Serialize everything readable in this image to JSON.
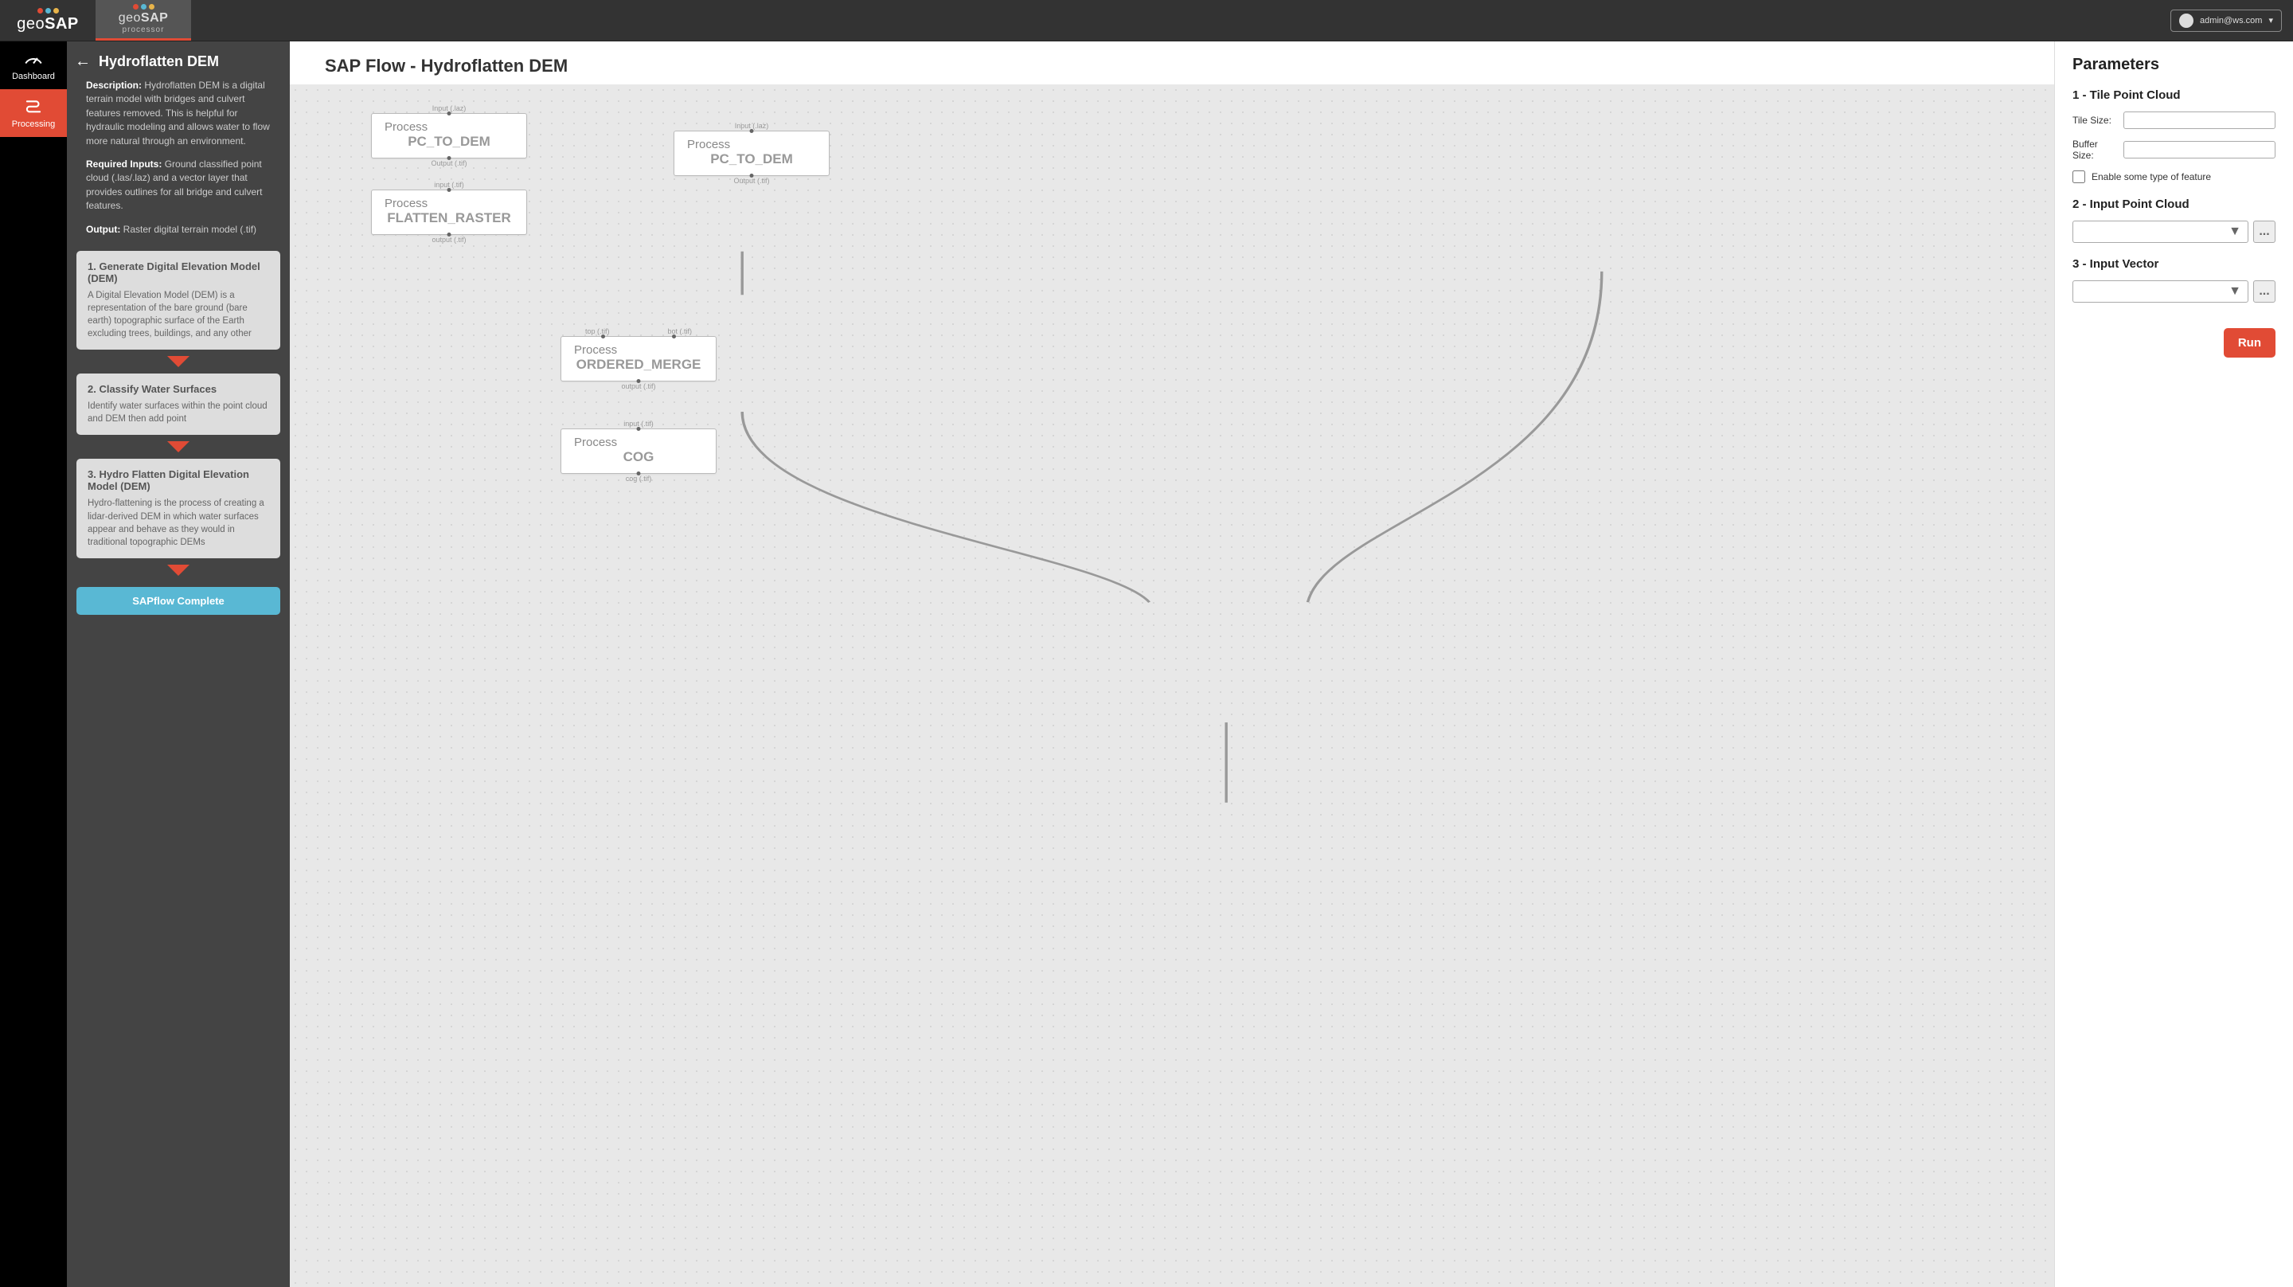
{
  "header": {
    "brand": "geoSAP",
    "tool": "geoSAP",
    "tool_sub": "processor",
    "user": "admin@ws.com"
  },
  "nav": {
    "dashboard": "Dashboard",
    "processing": "Processing"
  },
  "side": {
    "title": "Hydroflatten DEM",
    "desc_label": "Description:",
    "desc": "Hydroflatten DEM is a digital terrain model with bridges and culvert features removed. This is helpful for hydraulic modeling and allows water to flow more natural through an environment.",
    "inputs_label": "Required Inputs:",
    "inputs": "Ground classified point cloud (.las/.laz) and a vector layer that provides outlines for all bridge and culvert features.",
    "output_label": "Output:",
    "output": "Raster digital terrain model  (.tif)",
    "steps": [
      {
        "title": "1. Generate Digital Elevation Model (DEM)",
        "desc": "A Digital Elevation Model (DEM) is a representation of the bare ground (bare earth) topographic surface of the Earth excluding trees, buildings, and any other"
      },
      {
        "title": "2. Classify Water Surfaces",
        "desc": "Identify water surfaces within the point cloud and DEM then add point"
      },
      {
        "title": "3. Hydro Flatten Digital Elevation Model (DEM)",
        "desc": "Hydro-flattening is the process of creating a lidar-derived DEM in which water surfaces appear and behave as they would in traditional topographic DEMs"
      }
    ],
    "complete": "SAPflow Complete"
  },
  "canvas": {
    "title": "SAP Flow - Hydroflatten DEM",
    "nodes": {
      "n1": {
        "proc": "Process",
        "name": "PC_TO_DEM",
        "in": "Input (.laz)",
        "out": "Output (.tif)"
      },
      "n2": {
        "proc": "Process",
        "name": "FLATTEN_RASTER",
        "in": "input (.tif)",
        "out": "output (.tif)"
      },
      "n3": {
        "proc": "Process",
        "name": "PC_TO_DEM",
        "in": "Input (.laz)",
        "out": "Output (.tif)"
      },
      "n4": {
        "proc": "Process",
        "name": "ORDERED_MERGE",
        "in_l": "top (.tif)",
        "in_r": "bot (.tif)",
        "out": "output (.tif)"
      },
      "n5": {
        "proc": "Process",
        "name": "COG",
        "in": "input (.tif)",
        "out": "cog (.tif)"
      }
    }
  },
  "params": {
    "title": "Parameters",
    "s1": "1 - Tile Point Cloud",
    "tile_size_label": "Tile Size:",
    "buffer_size_label": "Buffer Size:",
    "feature_chk": "Enable some type of feature",
    "s2": "2 - Input Point Cloud",
    "s3": "3 - Input Vector",
    "dropdown_caret": "▼",
    "browse": "...",
    "run": "Run"
  }
}
